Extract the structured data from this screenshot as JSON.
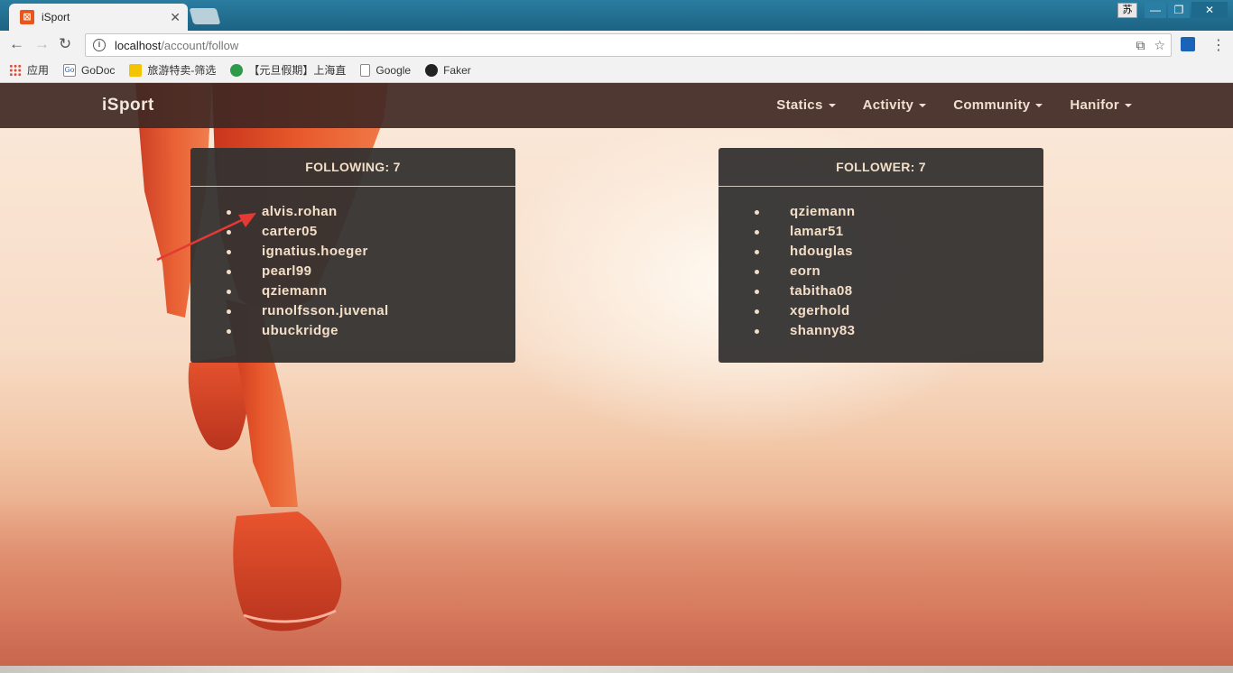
{
  "browser": {
    "tab_title": "iSport",
    "tab_favicon": "xampp-icon",
    "ime_indicator": "苏",
    "url_host": "localhost",
    "url_path": "/account/follow",
    "bookmarks": [
      {
        "label": "应用",
        "icon": "apps-grid-icon"
      },
      {
        "label": "GoDoc",
        "icon": "godoc-icon"
      },
      {
        "label": "旅游特卖-筛选",
        "icon": "travel-icon"
      },
      {
        "label": "【元旦假期】上海直",
        "icon": "green-circle-icon"
      },
      {
        "label": "Google",
        "icon": "page-icon"
      },
      {
        "label": "Faker",
        "icon": "github-icon"
      }
    ]
  },
  "navbar": {
    "brand": "iSport",
    "menu": [
      "Statics",
      "Activity",
      "Community",
      "Hanifor"
    ]
  },
  "following": {
    "title": "FOLLOWING: 7",
    "users": [
      "alvis.rohan",
      "carter05",
      "ignatius.hoeger",
      "pearl99",
      "qziemann",
      "runolfsson.juvenal",
      "ubuckridge"
    ]
  },
  "follower": {
    "title": "FOLLOWER: 7",
    "users": [
      "qziemann",
      "lamar51",
      "hdouglas",
      "eorn",
      "tabitha08",
      "xgerhold",
      "shanny83"
    ]
  },
  "colors": {
    "navbar": "#402824",
    "panel": "#343230",
    "panel_text": "#f3dec7",
    "annotation_arrow": "#e53935"
  }
}
